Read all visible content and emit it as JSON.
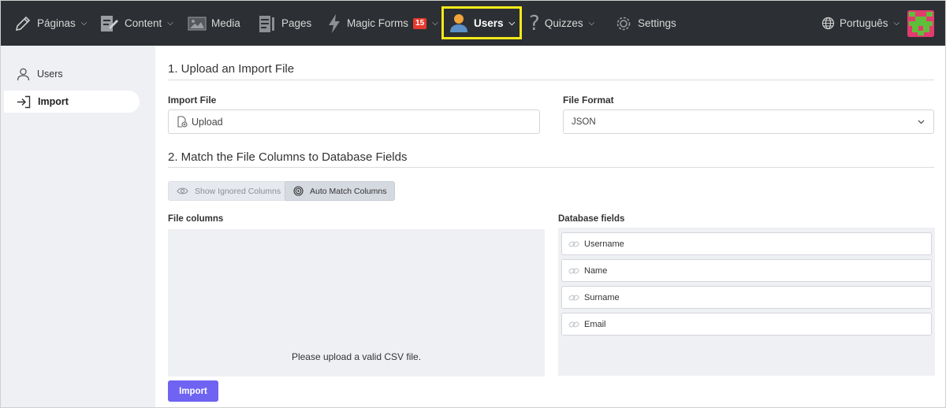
{
  "nav": {
    "paginas": "Páginas",
    "content": "Content",
    "media": "Media",
    "pages": "Pages",
    "magic_forms": "Magic Forms",
    "magic_forms_badge": "15",
    "users": "Users",
    "quizzes": "Quizzes",
    "settings": "Settings",
    "language": "Português"
  },
  "sidebar": {
    "items": [
      {
        "label": "Users",
        "icon": "user-icon",
        "active": false
      },
      {
        "label": "Import",
        "icon": "sign-in-icon",
        "active": true
      }
    ]
  },
  "section1": {
    "title": "1. Upload an Import File",
    "import_file_label": "Import File",
    "upload_text": "Upload",
    "file_format_label": "File Format",
    "file_format_value": "JSON"
  },
  "section2": {
    "title": "2. Match the File Columns to Database Fields",
    "show_ignored_label": "Show Ignored Columns",
    "auto_match_label": "Auto Match Columns",
    "file_columns_label": "File columns",
    "database_fields_label": "Database fields",
    "empty_message": "Please upload a valid CSV file.",
    "database_fields": [
      "Username",
      "Name",
      "Surname",
      "Email"
    ]
  },
  "import_button": "Import",
  "colors": {
    "topbar": "#2c2f33",
    "highlight": "#f5ea1a",
    "primary": "#6f63f2",
    "badge": "#e63a2e"
  }
}
